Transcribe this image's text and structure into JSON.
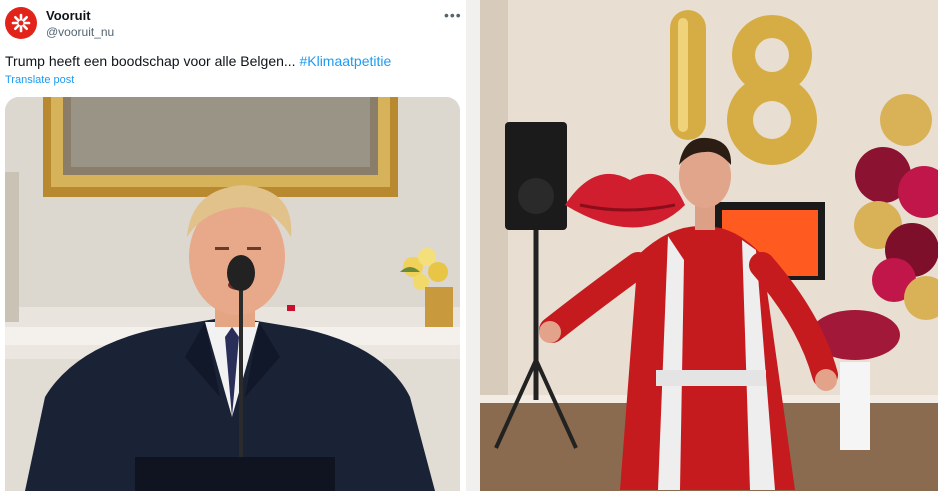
{
  "tweet": {
    "author_name": "Vooruit",
    "author_handle": "@vooruit_nu",
    "more_icon": "more-horizontal-icon",
    "text": "Trump heeft een boodschap voor alle Belgen... ",
    "hashtag": "#Klimaatpetitie",
    "translate_label": "Translate post",
    "avatar_icon": "asterisk-logo-icon",
    "brand_color": "#e2231a",
    "link_color": "#1d9bf0"
  },
  "media": {
    "left_image": "speaker-at-podium-photo",
    "right_video": "birthday-party-costume-video"
  },
  "video": {
    "balloon_text": "18"
  }
}
